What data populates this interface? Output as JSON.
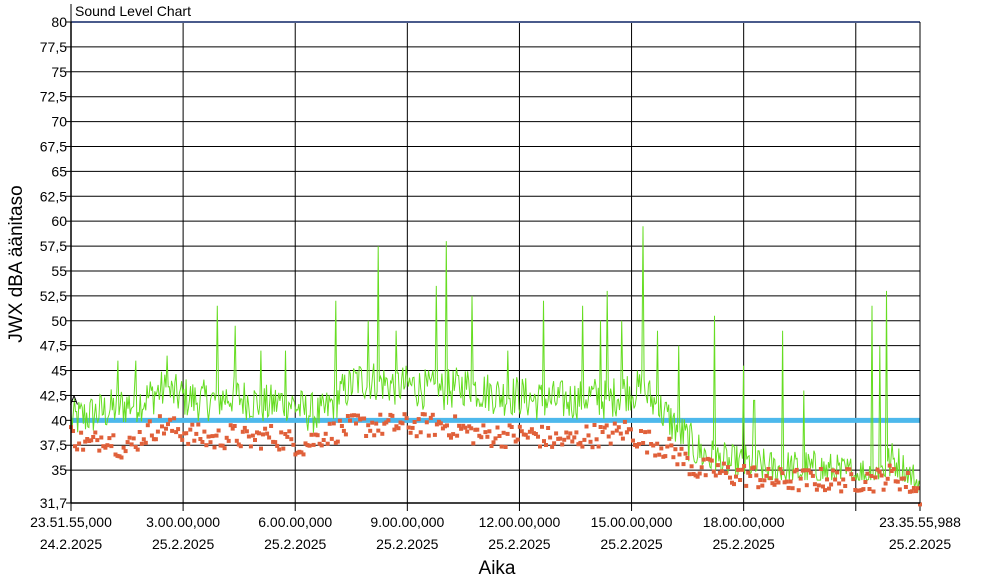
{
  "chart_data": {
    "type": "line",
    "title": "Sound Level Chart",
    "xlabel": "Aika",
    "ylabel": "JWX dBA äänitaso",
    "ylim": [
      31.7,
      80
    ],
    "y_ticks": [
      "80",
      "77,5",
      "75",
      "72,5",
      "70",
      "67,5",
      "65",
      "62,5",
      "60",
      "57,5",
      "55",
      "52,5",
      "50",
      "47,5",
      "45",
      "42,5",
      "40",
      "37,5",
      "35",
      "31,7"
    ],
    "x_range_hours": [
      0,
      23.7386
    ],
    "x_ticks": [
      {
        "time": "23.51.55,000",
        "date": "24.2.2025"
      },
      {
        "time": "3.00.00,000",
        "date": "25.2.2025"
      },
      {
        "time": "6.00.00,000",
        "date": "25.2.2025"
      },
      {
        "time": "9.00.00,000",
        "date": "25.2.2025"
      },
      {
        "time": "12.00.00,000",
        "date": "25.2.2025"
      },
      {
        "time": "15.00.00,000",
        "date": "25.2.2025"
      },
      {
        "time": "18.00.00,000",
        "date": "25.2.2025"
      },
      {
        "time": "",
        "date": ""
      },
      {
        "time": "23.35.55,988",
        "date": "25.2.2025"
      }
    ],
    "threshold": 40,
    "threshold_color": "#4db8ec",
    "line_color": "#66dd22",
    "marker_color": "#e0603a",
    "marker_label": "A",
    "grid": true,
    "series": [
      {
        "kind": "level",
        "x": [
          0,
          0.5,
          1,
          1.5,
          2,
          2.5,
          3,
          3.5,
          4,
          4.5,
          5,
          5.5,
          6,
          6.5,
          7,
          7.5,
          8,
          8.5,
          9,
          9.5,
          10,
          10.5,
          11,
          11.5,
          12,
          12.5,
          13,
          13.5,
          14,
          14.5,
          15,
          15.5,
          16,
          16.5,
          17,
          17.5,
          18,
          18.5,
          19,
          19.5,
          20,
          20.5,
          21,
          21.5,
          22,
          22.5,
          23,
          23.5,
          23.74
        ],
        "values": [
          40,
          40.5,
          41,
          41.5,
          42,
          43,
          42.5,
          42,
          42,
          42.5,
          42,
          41.5,
          42,
          41,
          40.5,
          42.5,
          44,
          44,
          43.5,
          43.5,
          43,
          43,
          43.5,
          43,
          42.5,
          42.5,
          42,
          42,
          42,
          42.5,
          42,
          43,
          43,
          41,
          39,
          37,
          36,
          35.5,
          35.5,
          35,
          35,
          35,
          35,
          34.5,
          34.5,
          34.5,
          36,
          34,
          33.5
        ]
      },
      {
        "kind": "spikes",
        "x": [
          1.3,
          1.8,
          2.7,
          4.1,
          4.6,
          5.3,
          6,
          7.4,
          8.3,
          8.6,
          9.1,
          10.2,
          10.5,
          11.2,
          12.2,
          13.2,
          14.3,
          14.8,
          15,
          15.4,
          16,
          16.4,
          17,
          18,
          18.8,
          19.1,
          19.9,
          20.5,
          22.4,
          22.6,
          22.8
        ],
        "values": [
          46,
          46,
          46.5,
          51.5,
          49.5,
          47,
          47,
          52,
          50,
          57.5,
          49,
          53.5,
          58,
          52.5,
          47,
          52,
          51.5,
          50,
          53,
          50,
          59.5,
          49,
          47.5,
          50.5,
          45.5,
          42,
          49,
          43,
          51.5,
          47.5,
          53
        ]
      },
      {
        "kind": "minimum",
        "x": [
          0,
          0.5,
          1,
          1.5,
          2,
          2.5,
          3,
          3.5,
          4,
          4.5,
          5,
          5.5,
          6,
          6.5,
          7,
          7.5,
          8,
          8.5,
          9,
          9.5,
          10,
          10.5,
          11,
          11.5,
          12,
          12.5,
          13,
          13.5,
          14,
          14.5,
          15,
          15.5,
          16,
          16.5,
          17,
          17.5,
          18,
          18.5,
          19,
          19.5,
          20,
          20.5,
          21,
          21.5,
          22,
          22.5,
          23,
          23.5,
          23.74
        ],
        "values": [
          38.5,
          37.5,
          38.5,
          37,
          38.5,
          39.5,
          39,
          38.5,
          38,
          38.5,
          38,
          38.5,
          38,
          37.5,
          38.5,
          39,
          39.5,
          39.5,
          39.5,
          39.5,
          39.5,
          39.5,
          39,
          38.5,
          38.5,
          38.5,
          38.5,
          38,
          38,
          38.5,
          38.5,
          39,
          38,
          37.5,
          36.5,
          35,
          35,
          34.5,
          34.5,
          34,
          34,
          34,
          34,
          34,
          34,
          34,
          34.5,
          33.5,
          32.5
        ]
      }
    ]
  }
}
